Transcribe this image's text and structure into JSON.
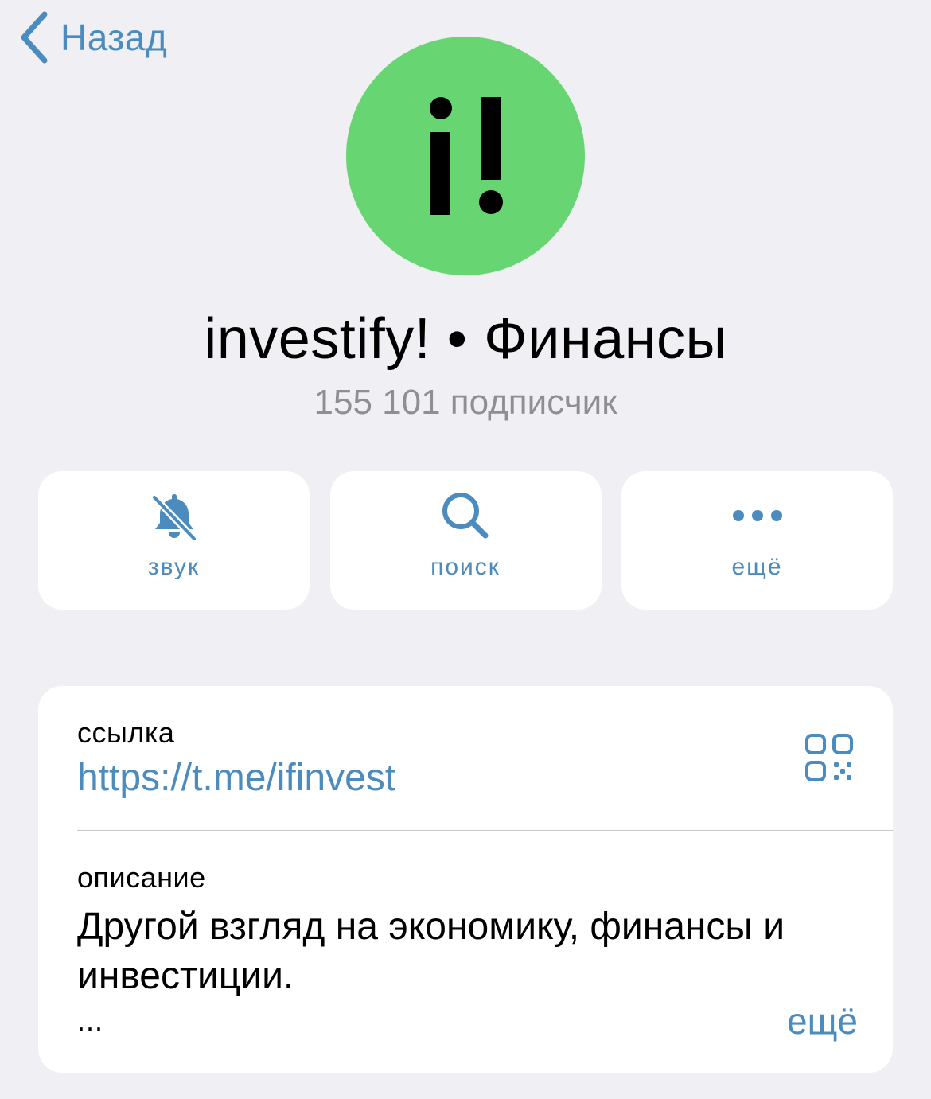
{
  "nav": {
    "back_label": "Назад"
  },
  "channel": {
    "avatar_text": "i!",
    "avatar_color": "#67d672",
    "title": "investify! • Финансы",
    "subscribers": "155 101 подписчик"
  },
  "actions": [
    {
      "icon": "bell-slash-icon",
      "label": "звук"
    },
    {
      "icon": "search-icon",
      "label": "поиск"
    },
    {
      "icon": "more-dots-icon",
      "label": "ещё"
    }
  ],
  "info": {
    "link_label": "ссылка",
    "link_value": "https://t.me/ifinvest",
    "link_icon": "qr-code-icon",
    "description_label": "описание",
    "description_text": "Другой взгляд на экономику, финансы и инвестиции.",
    "description_ellipsis": "...",
    "more_label": "ещё"
  },
  "colors": {
    "background": "#efeff4",
    "accent": "#4b8bbe",
    "secondary_text": "#8e8e93",
    "card": "#ffffff"
  }
}
